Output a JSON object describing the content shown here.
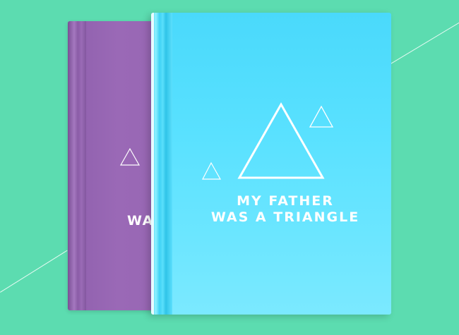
{
  "colors": {
    "background": "#5cdcb0",
    "back_book": "#9a69b6",
    "front_book": "#59e1ff",
    "text": "#ffffff"
  },
  "back_book": {
    "visible_title_fragment": "WA"
  },
  "front_book": {
    "title_line_1": "MY FATHER",
    "title_line_2": "WAS A TRIANGLE"
  },
  "icons": [
    "triangle-outline-icon"
  ]
}
